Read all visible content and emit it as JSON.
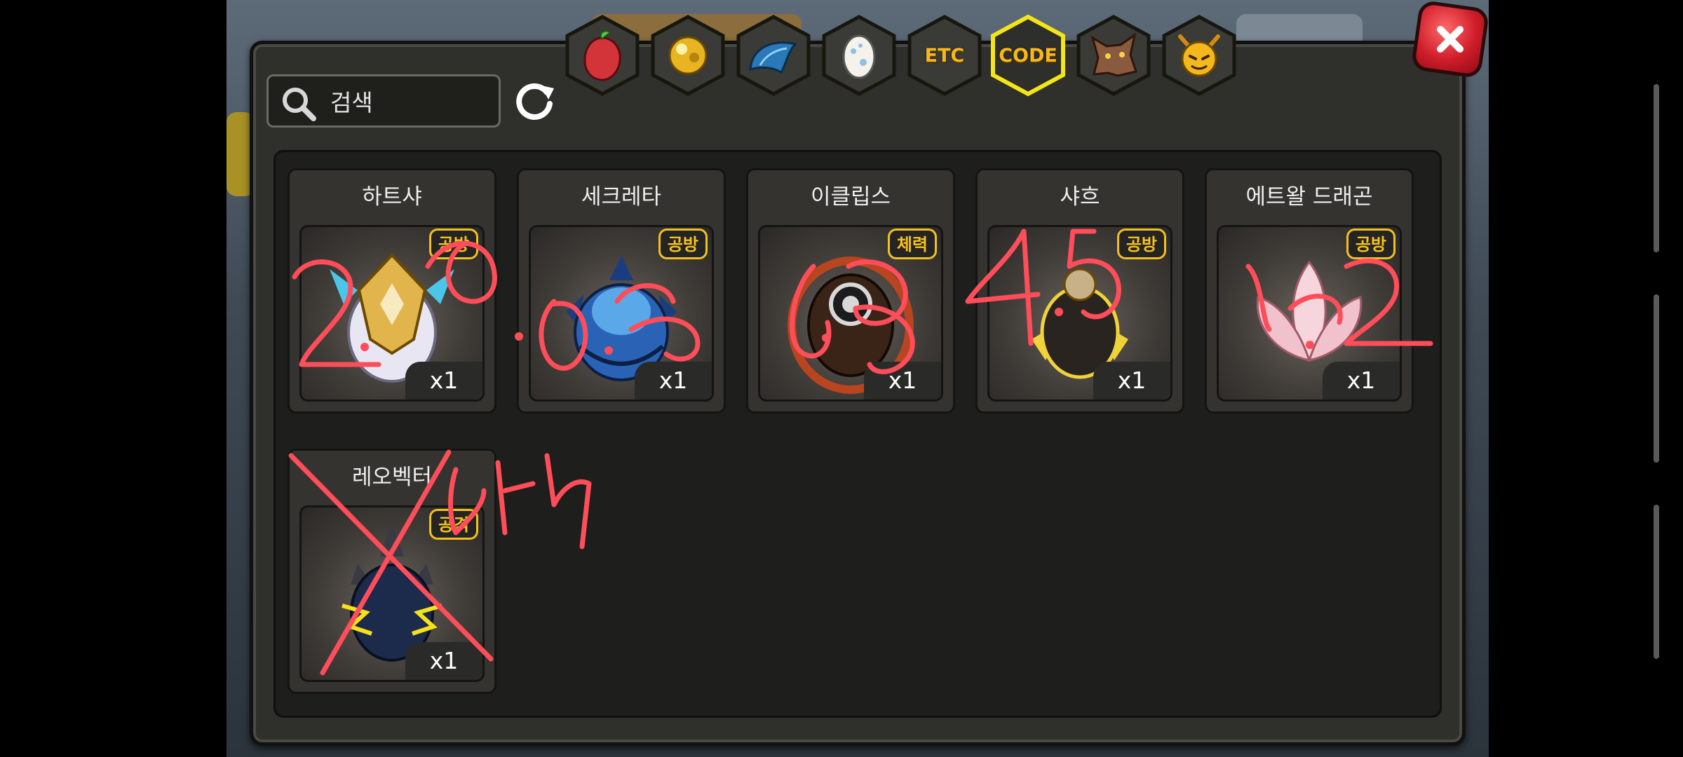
{
  "header": {
    "tabs": [
      {
        "id": "fruit",
        "icon": "fruit-icon",
        "label": ""
      },
      {
        "id": "gold",
        "icon": "gold-orb-icon",
        "label": ""
      },
      {
        "id": "scale",
        "icon": "blue-scale-icon",
        "label": ""
      },
      {
        "id": "egg",
        "icon": "egg-icon",
        "label": ""
      },
      {
        "id": "etc",
        "icon": "",
        "label": "ETC"
      },
      {
        "id": "code",
        "icon": "",
        "label": "CODE",
        "selected": true
      },
      {
        "id": "beast",
        "icon": "wolf-head-icon",
        "label": ""
      },
      {
        "id": "devil",
        "icon": "devil-face-icon",
        "label": ""
      }
    ]
  },
  "search": {
    "placeholder": "검색"
  },
  "items": [
    {
      "name": "하트샤",
      "badge": "공방",
      "qty": "x1",
      "icon": "white-gold-egg-icon"
    },
    {
      "name": "세크레타",
      "badge": "공방",
      "qty": "x1",
      "icon": "blue-spiked-egg-icon"
    },
    {
      "name": "이클립스",
      "badge": "체력",
      "qty": "x1",
      "icon": "eclipse-egg-icon"
    },
    {
      "name": "샤흐",
      "badge": "공방",
      "qty": "x1",
      "icon": "gold-orb-egg-icon"
    },
    {
      "name": "에트왈 드래곤",
      "badge": "공방",
      "qty": "x1",
      "icon": "pink-lotus-egg-icon"
    },
    {
      "name": "레오벡터",
      "badge": "공격",
      "qty": "x1",
      "icon": "dark-lightning-egg-icon"
    }
  ],
  "colors": {
    "accent": "#f2c21a",
    "close": "#d01d2a",
    "scribble": "#ff4d5a"
  }
}
